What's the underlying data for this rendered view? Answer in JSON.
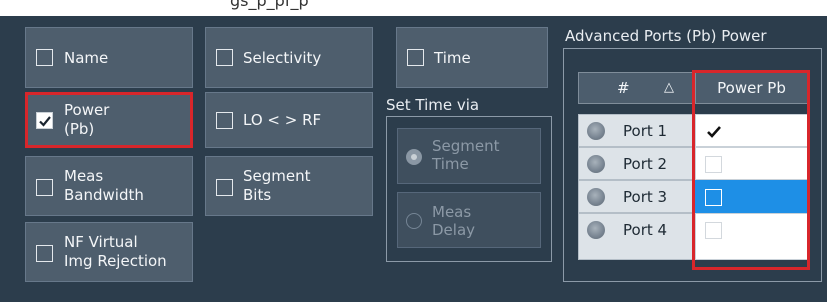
{
  "header": {
    "fragment": "gs_p_pf_p"
  },
  "options": {
    "name": {
      "label": "Name",
      "checked": false
    },
    "selectivity": {
      "label": "Selectivity",
      "checked": false
    },
    "time": {
      "label": "Time",
      "checked": false
    },
    "power": {
      "line1": "Power",
      "line2": "(Pb)",
      "checked": true
    },
    "lo_rf": {
      "label": "LO < > RF",
      "checked": false
    },
    "meas_bw": {
      "line1": "Meas",
      "line2": "Bandwidth",
      "checked": false
    },
    "segment_bits": {
      "line1": "Segment",
      "line2": "Bits",
      "checked": false
    },
    "nf_virtual": {
      "line1": "NF Virtual",
      "line2": "Img Rejection",
      "checked": false
    }
  },
  "set_time": {
    "title": "Set Time via",
    "segment_time": {
      "line1": "Segment",
      "line2": "Time",
      "selected": true
    },
    "meas_delay": {
      "line1": "Meas",
      "line2": "Delay",
      "selected": false
    }
  },
  "advanced": {
    "title": "Advanced Ports (Pb) Power",
    "col_number": "#",
    "sort_indicator": "△",
    "col_power": "Power Pb",
    "rows": [
      {
        "port": "Port 1",
        "power_pb": true
      },
      {
        "port": "Port 2",
        "power_pb": false
      },
      {
        "port": "Port 3",
        "power_pb": false
      },
      {
        "port": "Port 4",
        "power_pb": false
      }
    ],
    "selected_row": "Port 3"
  },
  "colors": {
    "highlight": "#d8262b",
    "selection": "#1e8fe6",
    "panel": "#2c3d4c"
  }
}
